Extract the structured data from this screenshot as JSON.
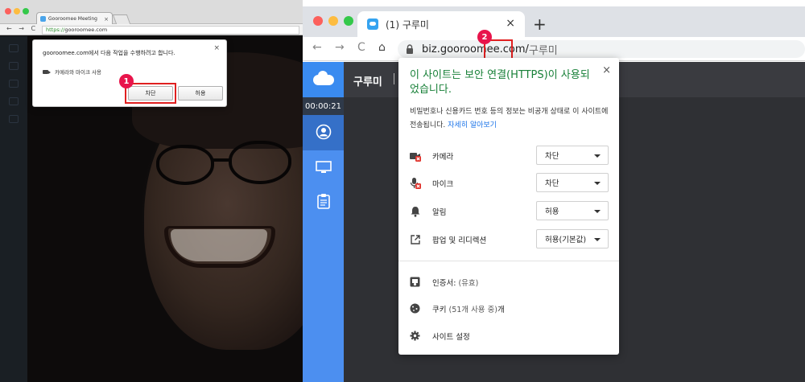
{
  "left_browser": {
    "tab_title": "Gooroomee Meeting",
    "tab_close": "×",
    "nav_glyphs": "← → C",
    "url_secure": "https://",
    "url_rest": "gooroomee.com",
    "permission_prompt": {
      "title": "gooroomee.com에서 다음 작업을 수행하려고 합니다.",
      "item": "카메라와 마이크 사용",
      "close": "×",
      "block_label": "차단",
      "allow_label": "허용"
    }
  },
  "annotations": {
    "marker_1": "1",
    "marker_2": "2"
  },
  "right_browser": {
    "tab_title": "(1) 구루미",
    "tab_close": "×",
    "new_tab": "+",
    "nav": {
      "back": "←",
      "forward": "→",
      "reload": "C",
      "home": "⌂"
    },
    "url_host": "biz.gooroomee.com/",
    "url_path": "구루미",
    "app": {
      "title": "구루미",
      "timer": "00:00:21"
    }
  },
  "site_info": {
    "title": "이 사이트는 보안 연결(HTTPS)이 사용되었습니다.",
    "close": "×",
    "desc": "비밀번호나 신용카드 번호 등의 정보는 비공개 상태로 이 사이트에 전송됩니다.",
    "learn_more": "자세히 알아보기",
    "permissions": [
      {
        "icon": "camera-blocked-icon",
        "label": "카메라",
        "value": "차단"
      },
      {
        "icon": "mic-blocked-icon",
        "label": "마이크",
        "value": "차단"
      },
      {
        "icon": "bell-icon",
        "label": "알림",
        "value": "허용"
      },
      {
        "icon": "popup-icon",
        "label": "팝업 및 리디렉션",
        "value": "허용(기본값)"
      }
    ],
    "certificate": {
      "label": "인증서:",
      "status": "(유효)"
    },
    "cookies": {
      "label": "쿠키",
      "detail": "(51개 사용 중)",
      "suffix": "개"
    },
    "site_settings": "사이트 설정"
  },
  "colors": {
    "secure_green": "#188038",
    "link_blue": "#1a73e8",
    "annotation_red": "#e02020",
    "badge_pink": "#e8144b",
    "app_blue": "#4c8ff0"
  }
}
